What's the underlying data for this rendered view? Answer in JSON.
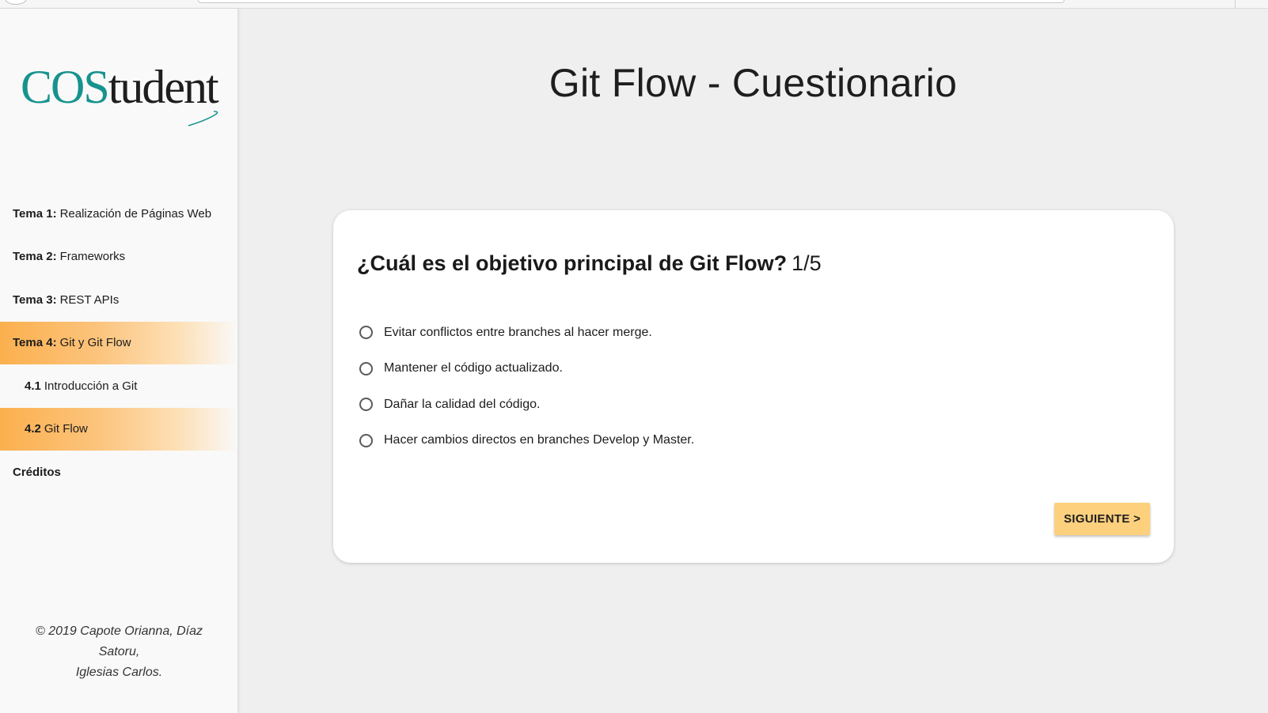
{
  "logo": {
    "part1": "COS",
    "part2": "tudent"
  },
  "sidebar": {
    "items": [
      {
        "num": "Tema 1:",
        "label": "Realización de Páginas Web"
      },
      {
        "num": "Tema 2:",
        "label": "Frameworks"
      },
      {
        "num": "Tema 3:",
        "label": "REST APIs"
      },
      {
        "num": "Tema 4:",
        "label": "Git y Git Flow"
      },
      {
        "num": "4.1",
        "label": "Introducción a Git"
      },
      {
        "num": "4.2",
        "label": "Git Flow"
      },
      {
        "label": "Créditos"
      }
    ],
    "copyright_line1": "© 2019 Capote Orianna, Díaz Satoru,",
    "copyright_line2": "Iglesias Carlos."
  },
  "main": {
    "title": "Git Flow - Cuestionario",
    "question": "¿Cuál es el objetivo principal de Git Flow?",
    "counter": "1/5",
    "options": [
      "Evitar conflictos entre branches al hacer merge.",
      "Mantener el código actualizado.",
      "Dañar la calidad del código.",
      "Hacer cambios directos en branches Develop y Master."
    ],
    "next_label": "SIGUIENTE >"
  },
  "colors": {
    "accent": "#fbb04e",
    "button": "#fdd07e",
    "logo_teal": "#17938e"
  }
}
